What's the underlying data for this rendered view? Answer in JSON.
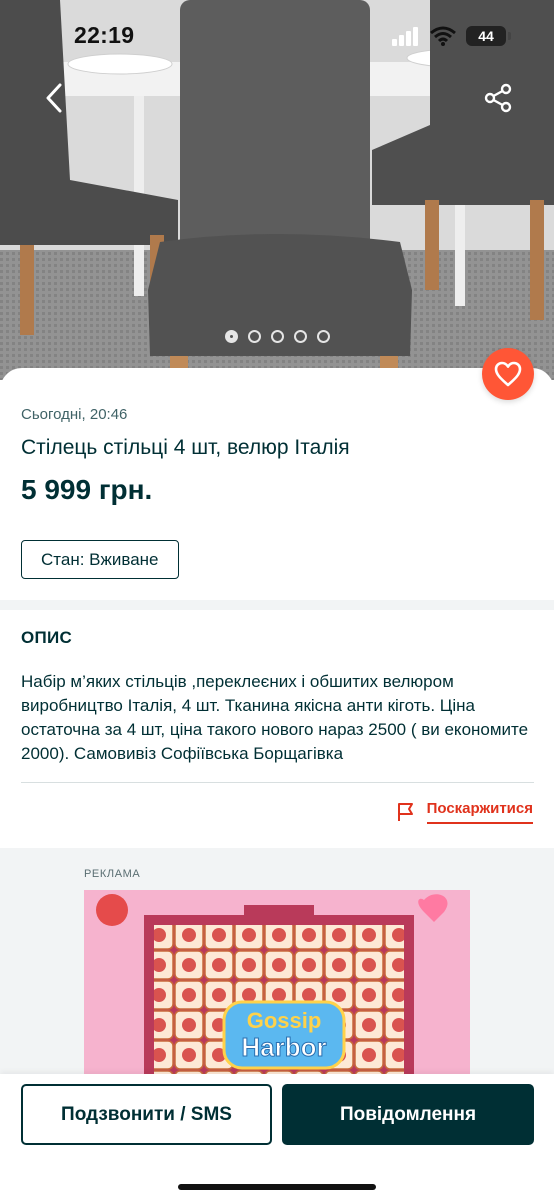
{
  "status_bar": {
    "time": "22:19",
    "battery": "44"
  },
  "gallery": {
    "photo_count": 5,
    "active_index": 0
  },
  "listing": {
    "date": "Сьогодні, 20:46",
    "title": "Стілець стільці 4 шт, велюр Італія",
    "price": "5 999 грн.",
    "condition": "Стан: Вживане"
  },
  "description": {
    "heading": "ОПИС",
    "text": "Набір м’яких стільців ,переклеєних  і обшитих велюром виробництво Італія, 4 шт. Тканина якісна анти кіготь. Ціна остаточна за 4 шт, ціна такого нового нараз 2500 ( ви економите 2000). Самовивіз Софіївська Борщагівка"
  },
  "report_label": "Поскаржитися",
  "ad": {
    "label": "РЕКЛАМА",
    "logo_line1": "Gossip",
    "logo_line2": "Harbor"
  },
  "actions": {
    "call_label": "Подзвонити / SMS",
    "message_label": "Повідомлення"
  },
  "colors": {
    "accent": "#ff5636",
    "dark": "#002f34",
    "report": "#e0321c",
    "ad_bg": "#f3a7c6"
  },
  "icons": [
    "back-arrow-icon",
    "share-icon",
    "heart-icon",
    "flag-icon",
    "signal-icon",
    "wifi-icon",
    "battery-icon"
  ]
}
